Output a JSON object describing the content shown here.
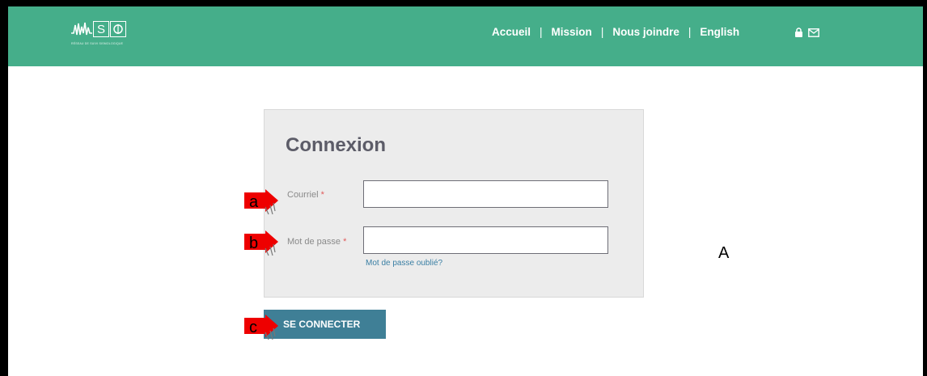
{
  "header": {
    "logo_text": "WSO",
    "logo_tagline": "RÉSEAU DE SUIVI SISMOLOGIQUE",
    "nav": [
      "Accueil",
      "Mission",
      "Nous joindre",
      "English"
    ],
    "separator": "|",
    "icons": [
      "lock-icon",
      "envelope-icon"
    ],
    "background_color": "#45ae8a"
  },
  "login": {
    "title": "Connexion",
    "email_label": "Courriel",
    "email_value": "",
    "password_label": "Mot de passe",
    "password_value": "",
    "required_mark": "*",
    "forgot_password": "Mot de passe oublié?",
    "submit_label": "SE CONNECTER",
    "button_color": "#3f7f96"
  },
  "annotations": {
    "markers": [
      "a",
      "b",
      "c"
    ],
    "region_label": "A",
    "marker_color": "#ee0000"
  }
}
